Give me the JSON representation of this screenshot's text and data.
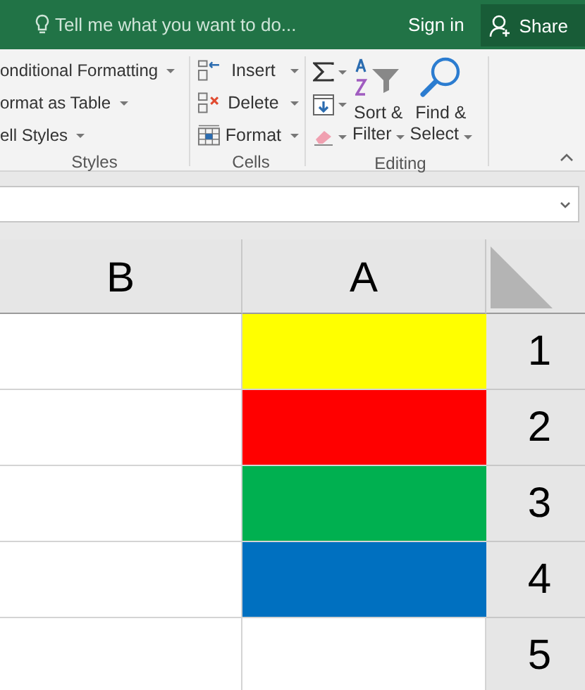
{
  "title_bar": {
    "search_placeholder": "Tell me what you want to do...",
    "sign_in": "Sign in",
    "share": "Share"
  },
  "ribbon": {
    "styles": {
      "label": "Styles",
      "items": [
        "onditional Formatting",
        "ormat as Table",
        "ell Styles"
      ]
    },
    "cells": {
      "label": "Cells",
      "items": [
        "Insert",
        "Delete",
        "Format"
      ]
    },
    "editing": {
      "label": "Editing",
      "large_buttons": [
        {
          "lines": [
            "Sort &",
            "Filter"
          ]
        },
        {
          "lines": [
            "Find &",
            "Select"
          ]
        }
      ]
    }
  },
  "sheet": {
    "columns": [
      "B",
      "A"
    ],
    "rows": [
      {
        "number": "1",
        "color": "#ffff00"
      },
      {
        "number": "2",
        "color": "#ff0000"
      },
      {
        "number": "3",
        "color": "#00b050"
      },
      {
        "number": "4",
        "color": "#0070c0"
      },
      {
        "number": "5"
      }
    ]
  }
}
